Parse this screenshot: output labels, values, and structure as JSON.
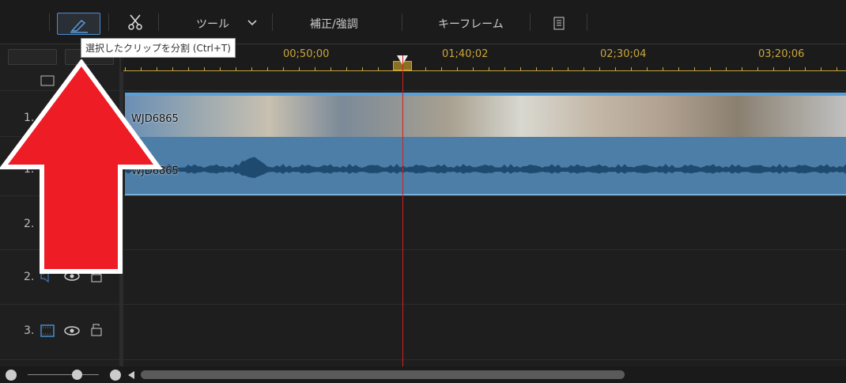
{
  "toolbar": {
    "tools_label": "ツール",
    "enhance_label": "補正/強調",
    "keyframe_label": "キーフレーム"
  },
  "tooltip": "選択したクリップを分割 (Ctrl+T)",
  "ruler": {
    "labels": [
      "00;50;00",
      "01;40;02",
      "02;30;04",
      "03;20;06"
    ]
  },
  "tracks": [
    {
      "num": "1."
    },
    {
      "num": "1."
    },
    {
      "num": "2."
    },
    {
      "num": "2."
    },
    {
      "num": "3."
    }
  ],
  "clip": {
    "video_name": "WJD6865",
    "audio_name": "WJD6865"
  },
  "colors": {
    "accent": "#4a8ccf",
    "playhead": "#d02020",
    "ruler": "#c9a63a",
    "arrow": "#ee1c25"
  }
}
